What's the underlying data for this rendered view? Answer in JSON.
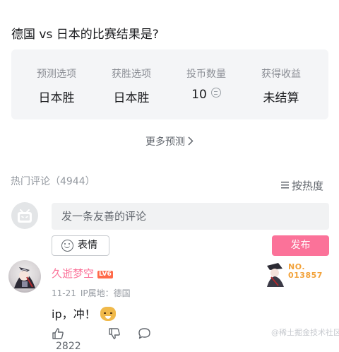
{
  "question": "德国 vs 日本的比赛结果是?",
  "prediction": {
    "columns": [
      {
        "label": "预测选项",
        "value": "日本胜"
      },
      {
        "label": "获胜选项",
        "value": "日本胜"
      },
      {
        "label": "投币数量",
        "value": "10",
        "icon": "coin-icon"
      },
      {
        "label": "获得收益",
        "value": "未结算"
      }
    ]
  },
  "more_predictions": "更多预测",
  "comments_header": {
    "title": "热门评论（4944）",
    "sort_label": "按热度"
  },
  "composer": {
    "placeholder": "发一条友善的评论",
    "emoji_button": "表情",
    "publish_button": "发布"
  },
  "comment": {
    "username": "久逝梦空",
    "level": "LV6",
    "fan_badge": "NO.\n013857",
    "date": "11-21",
    "location": "IP属地：德国",
    "text": "ip，冲！",
    "likes": "2822"
  },
  "watermark": "@稀土掘金技术社区",
  "colors": {
    "accent_pink": "#fb7299",
    "card_bg": "#f4f5f7",
    "muted_text": "#9499a0"
  }
}
